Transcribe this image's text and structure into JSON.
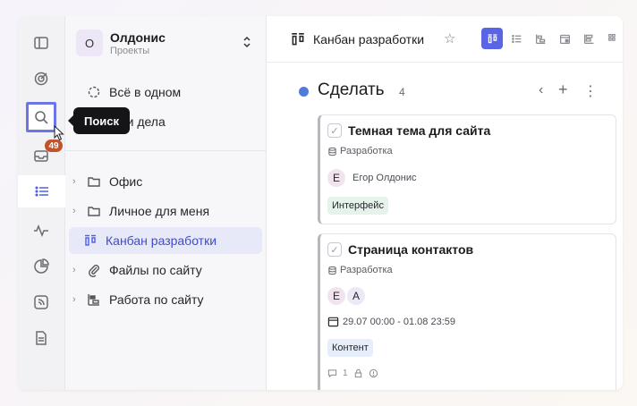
{
  "rail": {
    "inbox_badge": "49",
    "tooltip": "Поиск",
    "icons": [
      "sidebar-toggle-icon",
      "target-icon",
      "search-icon",
      "inbox-icon",
      "list-icon",
      "activity-icon",
      "pie-chart-icon",
      "feed-icon",
      "document-icon"
    ]
  },
  "workspace": {
    "avatar": "О",
    "name": "Олдонис",
    "subtitle": "Проекты"
  },
  "sidebar": {
    "all_in_one": "Всё в одном",
    "my_tasks": "Мои дела",
    "items": [
      {
        "label": "Офис",
        "icon": "folder-icon"
      },
      {
        "label": "Личное для меня",
        "icon": "folder-icon"
      },
      {
        "label": "Канбан разработки",
        "icon": "kanban-icon"
      },
      {
        "label": "Файлы по сайту",
        "icon": "paperclip-icon"
      },
      {
        "label": "Работа по сайту",
        "icon": "gantt-icon"
      }
    ]
  },
  "header": {
    "title": "Канбан разработки"
  },
  "column": {
    "title": "Сделать",
    "count": "4",
    "color": "#4f7bd9"
  },
  "cards": [
    {
      "title": "Темная тема для сайта",
      "project": "Разработка",
      "avatar": "Е",
      "assignee": "Егор Олдонис",
      "tag": "Интерфейс"
    },
    {
      "title": "Страница контактов",
      "project": "Разработка",
      "avatars": [
        "Е",
        "А"
      ],
      "date": "29.07 00:00 - 01.08 23:59",
      "tag": "Контент",
      "comments": "1"
    }
  ],
  "colors": {
    "accent": "#5a65e6",
    "badge": "#c0522c"
  }
}
